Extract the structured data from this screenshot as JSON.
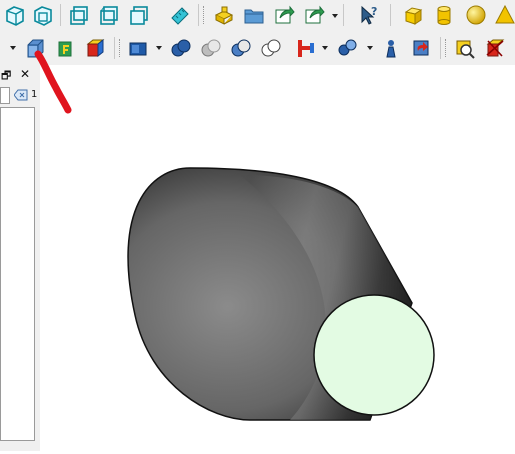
{
  "panel": {
    "restore_glyph": "🗗",
    "close_glyph": "✕",
    "filter_count": "1"
  },
  "toolbar1": {
    "icons": [
      "view-front-icon",
      "view-back-icon",
      "view-fit-icon",
      "view-iso-icon",
      "view-box-icon",
      "measure-ruler-icon",
      "open-part-icon",
      "open-folder-icon",
      "import-icon",
      "export-icon",
      "whats-this-icon",
      "box-primitive-icon",
      "cylinder-primitive-icon",
      "sphere-primitive-icon",
      "cone-primitive-icon"
    ]
  },
  "toolbar2": {
    "icons": [
      "face-icon",
      "shell-icon",
      "solid-icon",
      "compound-icon",
      "boolean-fuse-icon",
      "boolean-cut-icon",
      "boolean-common-icon",
      "boolean-section-icon",
      "extrude-icon",
      "revolve-icon",
      "sweep-icon",
      "loft-icon",
      "measure-distance-icon",
      "check-geometry-icon"
    ]
  },
  "annotation": {
    "color": "#e0141e",
    "target": "face-icon"
  },
  "viewport": {
    "shape": "truncated-cone",
    "body_color": "#6d6d6d",
    "end_face_color": "#e3fbe3",
    "outline_color": "#111111"
  }
}
